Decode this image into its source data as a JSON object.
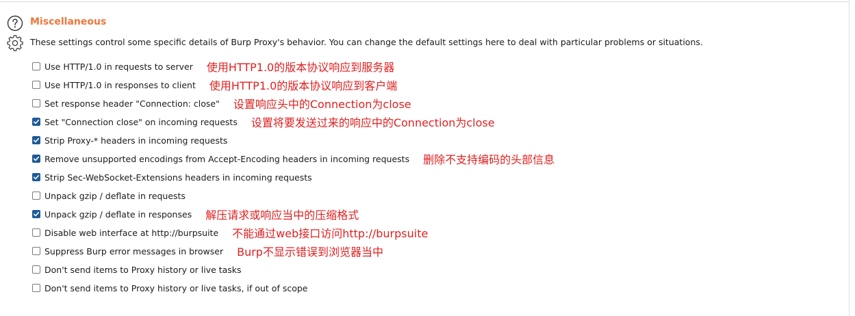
{
  "section": {
    "title": "Miscellaneous",
    "description": "These settings control some specific details of Burp Proxy's behavior. You can change the default settings here to deal with particular problems or situations."
  },
  "options": [
    {
      "label": "Use HTTP/1.0 in requests to server",
      "checked": false,
      "annotation": "使用HTTP1.0的版本协议响应到服务器"
    },
    {
      "label": "Use HTTP/1.0 in responses to client",
      "checked": false,
      "annotation": "使用HTTP1.0的版本协议响应到客户端"
    },
    {
      "label": "Set response header \"Connection: close\"",
      "checked": false,
      "annotation": "设置响应头中的Connection为close"
    },
    {
      "label": "Set \"Connection close\" on incoming requests",
      "checked": true,
      "annotation": "设置将要发送过来的响应中的Connection为close"
    },
    {
      "label": "Strip Proxy-* headers in incoming requests",
      "checked": true,
      "annotation": ""
    },
    {
      "label": "Remove unsupported encodings from Accept-Encoding headers in incoming requests",
      "checked": true,
      "annotation": "删除不支持编码的头部信息"
    },
    {
      "label": "Strip Sec-WebSocket-Extensions headers in incoming requests",
      "checked": true,
      "annotation": ""
    },
    {
      "label": "Unpack gzip / deflate in requests",
      "checked": false,
      "annotation": ""
    },
    {
      "label": "Unpack gzip / deflate in responses",
      "checked": true,
      "annotation": "解压请求或响应当中的压缩格式"
    },
    {
      "label": "Disable web interface at http://burpsuite",
      "checked": false,
      "annotation": "不能通过web接口访问http://burpsuite"
    },
    {
      "label": "Suppress Burp error messages in browser",
      "checked": false,
      "annotation": "Burp不显示错误到浏览器当中"
    },
    {
      "label": "Don't send items to Proxy history or live tasks",
      "checked": false,
      "annotation": ""
    },
    {
      "label": "Don't send items to Proxy history or live tasks, if out of scope",
      "checked": false,
      "annotation": ""
    }
  ],
  "icons": {
    "help": "help-circle-icon",
    "settings": "gear-icon"
  },
  "colors": {
    "title": "#f0763a",
    "annotation": "#e02020",
    "checkbox_checked": "#1f5b98"
  }
}
